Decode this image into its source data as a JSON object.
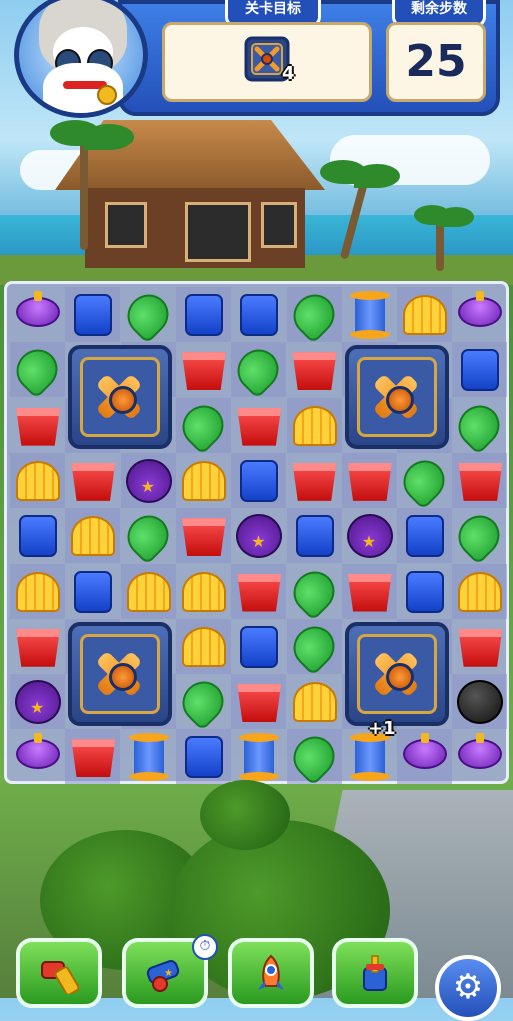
{
  "header": {
    "goal_label": "关卡目标",
    "goal_item": "safe-icon",
    "goal_count": "4",
    "moves_label": "剩余步数",
    "moves_left": "25"
  },
  "board": {
    "rows": 9,
    "cols": 9,
    "grid": [
      [
        "top",
        "cube",
        "leaf",
        "cube",
        "cube",
        "leaf",
        "spool",
        "shell",
        "top"
      ],
      [
        "leaf",
        "safe",
        "safe",
        "pot",
        "leaf",
        "pot",
        "safe",
        "safe",
        "cube"
      ],
      [
        "pot",
        "safe",
        "safe",
        "leaf",
        "pot",
        "shell",
        "safe",
        "safe",
        "leaf"
      ],
      [
        "shell",
        "pot",
        "orb",
        "shell",
        "cube",
        "pot",
        "pot",
        "leaf",
        "pot"
      ],
      [
        "cube",
        "shell",
        "leaf",
        "pot",
        "orb",
        "cube",
        "orb",
        "cube",
        "leaf"
      ],
      [
        "shell",
        "cube",
        "shell",
        "shell",
        "pot",
        "leaf",
        "pot",
        "cube",
        "shell"
      ],
      [
        "pot",
        "safe",
        "safe",
        "shell",
        "cube",
        "leaf",
        "safe",
        "safe",
        "pot"
      ],
      [
        "orb",
        "safe",
        "safe",
        "leaf",
        "pot",
        "shell",
        "safe",
        "safe",
        "bomb"
      ],
      [
        "top",
        "pot",
        "spool",
        "cube",
        "spool",
        "leaf",
        "spool",
        "top",
        "top"
      ]
    ],
    "safes": [
      [
        1,
        1
      ],
      [
        1,
        6
      ],
      [
        6,
        1
      ],
      [
        6,
        6
      ]
    ],
    "floating_text": "+1"
  },
  "boosters": [
    {
      "name": "hammer-booster",
      "icon": "hammer-icon"
    },
    {
      "name": "cannon-booster",
      "icon": "cannon-icon",
      "has_timer": true
    },
    {
      "name": "rocket-booster",
      "icon": "rocket-icon"
    },
    {
      "name": "plunger-booster",
      "icon": "plunger-icon"
    }
  ],
  "settings_icon": "gear-icon",
  "colors": {
    "header_blue": "#2350b8",
    "booster_green": "#2a9a20",
    "safe_gold": "#d6a640"
  }
}
